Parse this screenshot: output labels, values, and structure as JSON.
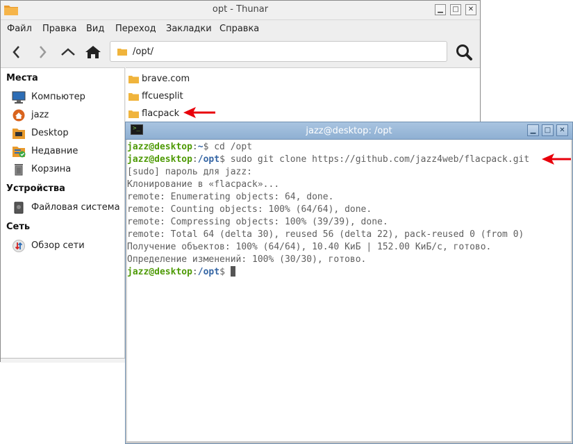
{
  "thunar": {
    "title": "opt - Thunar",
    "menu": [
      "Файл",
      "Правка",
      "Вид",
      "Переход",
      "Закладки",
      "Справка"
    ],
    "location": "/opt/",
    "sidebar": {
      "places_heading": "Места",
      "places": [
        {
          "label": "Компьютер",
          "icon": "computer-icon"
        },
        {
          "label": "jazz",
          "icon": "home-icon"
        },
        {
          "label": "Desktop",
          "icon": "desktop-folder-icon"
        },
        {
          "label": "Недавние",
          "icon": "recent-icon"
        },
        {
          "label": "Корзина",
          "icon": "trash-icon"
        }
      ],
      "devices_heading": "Устройства",
      "devices": [
        {
          "label": "Файловая система",
          "icon": "drive-icon"
        }
      ],
      "network_heading": "Сеть",
      "network": [
        {
          "label": "Обзор сети",
          "icon": "network-icon"
        }
      ]
    },
    "files": [
      "brave.com",
      "ffcuesplit",
      "flacpack"
    ]
  },
  "terminal": {
    "title": "jazz@desktop: /opt",
    "lines": [
      {
        "user": "jazz@desktop",
        "sep": ":",
        "path": "~",
        "prompt": "$",
        "cmd": " cd /opt"
      },
      {
        "user": "jazz@desktop",
        "sep": ":",
        "path": "/opt",
        "prompt": "$",
        "cmd": " sudo git clone https://github.com/jazz4web/flacpack.git"
      },
      {
        "text": "[sudo] пароль для jazz:"
      },
      {
        "text": "Клонирование в «flacpack»..."
      },
      {
        "text": "remote: Enumerating objects: 64, done."
      },
      {
        "text": "remote: Counting objects: 100% (64/64), done."
      },
      {
        "text": "remote: Compressing objects: 100% (39/39), done."
      },
      {
        "text": "remote: Total 64 (delta 30), reused 56 (delta 22), pack-reused 0 (from 0)"
      },
      {
        "text": "Получение объектов: 100% (64/64), 10.40 КиБ | 152.00 КиБ/с, готово."
      },
      {
        "text": "Определение изменений: 100% (30/30), готово."
      },
      {
        "user": "jazz@desktop",
        "sep": ":",
        "path": "/opt",
        "prompt": "$",
        "cmd": " "
      }
    ]
  },
  "colors": {
    "prompt_user": "#4e9a06",
    "prompt_path": "#3465a4",
    "folder": "#f0b43c",
    "annotation_arrow": "#e8000b"
  }
}
